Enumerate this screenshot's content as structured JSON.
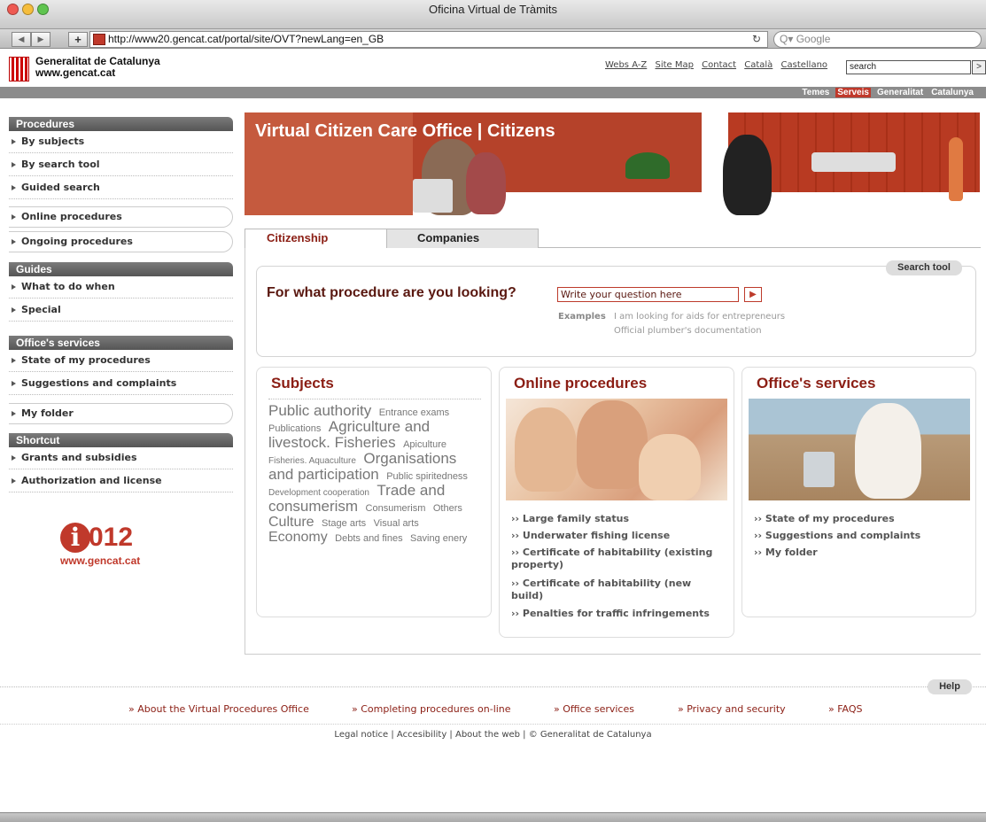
{
  "browser": {
    "window_title": "Oficina Virtual de Tràmits",
    "url": "http://www20.gencat.cat/portal/site/OVT?newLang=en_GB",
    "search_placeholder": "Q▾ Google",
    "reload_icon": "↻"
  },
  "header": {
    "brand_line1": "Generalitat de Catalunya",
    "brand_line2": "www.gencat.cat",
    "links": [
      "Webs A-Z",
      "Site Map",
      "Contact",
      "Català",
      "Castellano"
    ],
    "search_value": "search",
    "search_button": ">",
    "topnav": [
      "Temes",
      "Serveis",
      "Generalitat",
      "Catalunya"
    ],
    "topnav_active": "Serveis"
  },
  "sidebar": {
    "procedures_title": "Procedures",
    "procedures": [
      "By subjects",
      "By search tool",
      "Guided search",
      "Online procedures",
      "Ongoing procedures"
    ],
    "guides_title": "Guides",
    "guides": [
      "What to do when",
      "Special"
    ],
    "services_title": "Office's services",
    "services": [
      "State of my procedures",
      "Suggestions and complaints",
      "My folder"
    ],
    "shortcut_title": "Shortcut",
    "shortcuts": [
      "Grants and subsidies",
      "Authorization and license"
    ],
    "logo_i": "i",
    "logo_num": "012",
    "logo_url": "www.gencat.cat"
  },
  "banner": {
    "title": "Virtual Citizen Care Office | Citizens"
  },
  "tabs": [
    "Citizenship",
    "Companies"
  ],
  "search": {
    "tool_label": "Search tool",
    "question": "For what procedure are you looking?",
    "input_value": "Write your question here",
    "go": "▶",
    "examples_label": "Examples",
    "examples": [
      "I am looking for aids for entrepreneurs",
      "Official plumber's documentation"
    ]
  },
  "subjects": {
    "title": "Subjects",
    "cloud": [
      {
        "t": "Public authority",
        "s": 17
      },
      {
        "t": "Entrance exams",
        "s": 11
      },
      {
        "t": "Publications",
        "s": 11
      },
      {
        "t": "Agriculture and livestock. Fisheries",
        "s": 17
      },
      {
        "t": "Apiculture",
        "s": 11
      },
      {
        "t": "Fisheries. Aquaculture",
        "s": 10
      },
      {
        "t": "Organisations and participation",
        "s": 17
      },
      {
        "t": "Public spiritedness",
        "s": 11
      },
      {
        "t": "Development cooperation",
        "s": 10
      },
      {
        "t": "Trade and consumerism",
        "s": 17
      },
      {
        "t": "Consumerism",
        "s": 11
      },
      {
        "t": "Others",
        "s": 11
      },
      {
        "t": "Culture",
        "s": 16
      },
      {
        "t": "Stage arts",
        "s": 11
      },
      {
        "t": "Visual arts",
        "s": 11
      },
      {
        "t": "Economy",
        "s": 16
      },
      {
        "t": "Debts and fines",
        "s": 11
      },
      {
        "t": "Saving enery",
        "s": 11
      }
    ]
  },
  "online": {
    "title": "Online procedures",
    "links": [
      "Large family status",
      "Underwater fishing license",
      "Certificate of habitability (existing property)",
      "Certificate of habitability (new build)",
      "Penalties for traffic infringements"
    ]
  },
  "office": {
    "title": "Office's services",
    "links": [
      "State of my procedures",
      "Suggestions and complaints",
      "My folder"
    ]
  },
  "footer": {
    "help": "Help",
    "links": [
      "About the Virtual Procedures Office",
      "Completing procedures on-line",
      "Office services",
      "Privacy and security",
      "FAQS"
    ],
    "legal": "Legal notice | Accesibility | About the web | © Generalitat de Catalunya"
  },
  "colors": {
    "accent": "#c0392b",
    "dark_red": "#8b1e14",
    "sidebar_head": "#666666"
  }
}
